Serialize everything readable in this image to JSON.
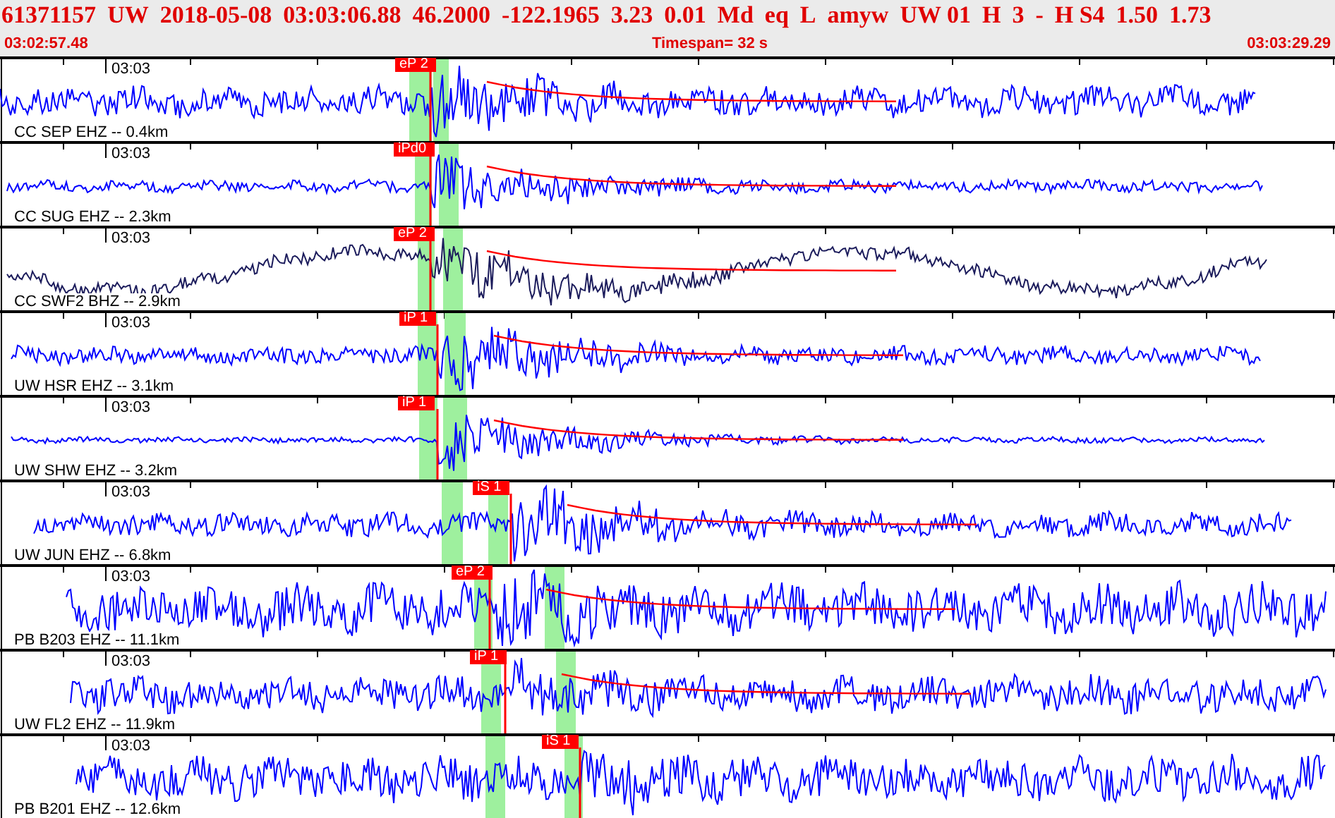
{
  "header": {
    "event_fields": [
      "61371157",
      "UW",
      "2018-05-08",
      "03:03:06.88",
      "46.2000",
      "-122.1965",
      "3.23",
      "0.01",
      "Md",
      "eq",
      "L",
      "amyw",
      "UW 01",
      "H",
      "3",
      "-",
      "H S4",
      "1.50",
      "1.73"
    ],
    "start_time": "03:02:57.48",
    "timespan": "Timespan=  32 s",
    "end_time": "03:03:29.29"
  },
  "traces": [
    {
      "time_label": "03:03",
      "channel": "CC SEP EHZ -- 0.4km",
      "color": "#0000ff",
      "pick": "eP 2"
    },
    {
      "time_label": "03:03",
      "channel": "CC SUG EHZ -- 2.3km",
      "color": "#0000ff",
      "pick": "iPd0"
    },
    {
      "time_label": "03:03",
      "channel": "CC SWF2 BHZ -- 2.9km",
      "color": "#1c1c5c",
      "pick": "eP 2"
    },
    {
      "time_label": "03:03",
      "channel": "UW HSR EHZ -- 3.1km",
      "color": "#0000ff",
      "pick": "iP 1"
    },
    {
      "time_label": "03:03",
      "channel": "UW SHW EHZ -- 3.2km",
      "color": "#0000ff",
      "pick": "iP 1"
    },
    {
      "time_label": "03:03",
      "channel": "UW JUN EHZ -- 6.8km",
      "color": "#0000ff",
      "pick": "iS 1"
    },
    {
      "time_label": "03:03",
      "channel": "PB B203 EHZ -- 11.1km",
      "color": "#0000ff",
      "pick": "eP 2"
    },
    {
      "time_label": "03:03",
      "channel": "UW FL2 EHZ -- 11.9km",
      "color": "#0000ff",
      "pick": "iP 1"
    },
    {
      "time_label": "03:03",
      "channel": "PB B201 EHZ -- 12.6km",
      "color": "#0000ff",
      "pick": "iS 1"
    }
  ]
}
